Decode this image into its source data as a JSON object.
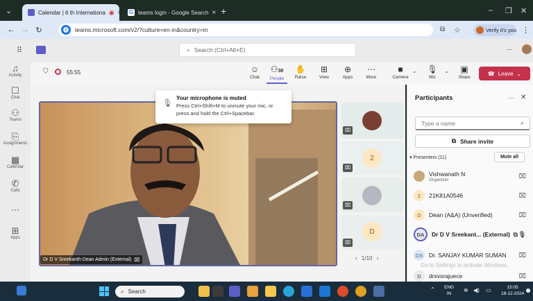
{
  "browser": {
    "tabs": [
      {
        "label": "Calendar | 6 th Internationa",
        "active": true
      },
      {
        "label": "teams login - Google Search",
        "active": false
      }
    ],
    "url": "teams.microsoft.com/v2/?culture=en-in&country=in",
    "verify_label": "Verify it's you"
  },
  "teams": {
    "search_placeholder": "Search (Ctrl+Alt+E)",
    "rail": [
      {
        "label": "Activity",
        "icon": "bell-icon"
      },
      {
        "label": "Chat",
        "icon": "chat-icon"
      },
      {
        "label": "Teams",
        "icon": "teams-icon"
      },
      {
        "label": "Assignments",
        "icon": "assignments-icon"
      },
      {
        "label": "Calendar",
        "icon": "calendar-icon"
      },
      {
        "label": "Calls",
        "icon": "calls-icon"
      },
      {
        "label": "",
        "icon": "more-icon"
      },
      {
        "label": "Apps",
        "icon": "apps-icon"
      }
    ]
  },
  "meeting": {
    "timer": "55:55",
    "toolbar": {
      "chat": "Chat",
      "people": "People",
      "people_count": "38",
      "raise": "Raise",
      "view": "View",
      "apps": "Apps",
      "more": "More",
      "camera": "Camera",
      "mic": "Mic",
      "share": "Share",
      "leave": "Leave"
    },
    "mute_tip": {
      "title": "Your microphone is muted",
      "body": "Press Ctrl+Shift+M to unmute your mic, or press and hold the Ctrl+Spacebar."
    },
    "main_speaker": "Dr D V Sreekanth Dean Admin (External)",
    "tiles": [
      {
        "initial": ""
      },
      {
        "initial": "2"
      },
      {
        "initial": ""
      },
      {
        "initial": "D"
      }
    ],
    "pager": "1/10"
  },
  "participants": {
    "title": "Participants",
    "search_placeholder": "Type a name",
    "share_invite": "Share invite",
    "presenters_label": "Presenters (11)",
    "mute_all": "Mute all",
    "people": [
      {
        "initials": "",
        "name": "Vishwanath N",
        "role": "Organizer",
        "color": "#c8a77a"
      },
      {
        "initials": "2",
        "name": "21K81A0546",
        "role": "",
        "color": "#fde7c2"
      },
      {
        "initials": "D",
        "name": "Dean (A&A) (Unverified)",
        "role": "",
        "color": "#fde7c2"
      },
      {
        "initials": "DA",
        "name": "Dr D V Sreekant... (External)",
        "role": "",
        "color": "#e8e8f8"
      },
      {
        "initials": "DS",
        "name": "Dr. SANJAY KUMAR SUMAN",
        "role": "",
        "color": "#dbe7f7"
      },
      {
        "initials": "D",
        "name": "drsvsrajuece",
        "role": "",
        "color": "#e8e8e8"
      }
    ],
    "watermark": "Go to Settings to activate Windows."
  },
  "taskbar": {
    "search": "Search",
    "lang": "ENG",
    "region": "IN",
    "time": "15:05",
    "date": "18-12-2024"
  }
}
